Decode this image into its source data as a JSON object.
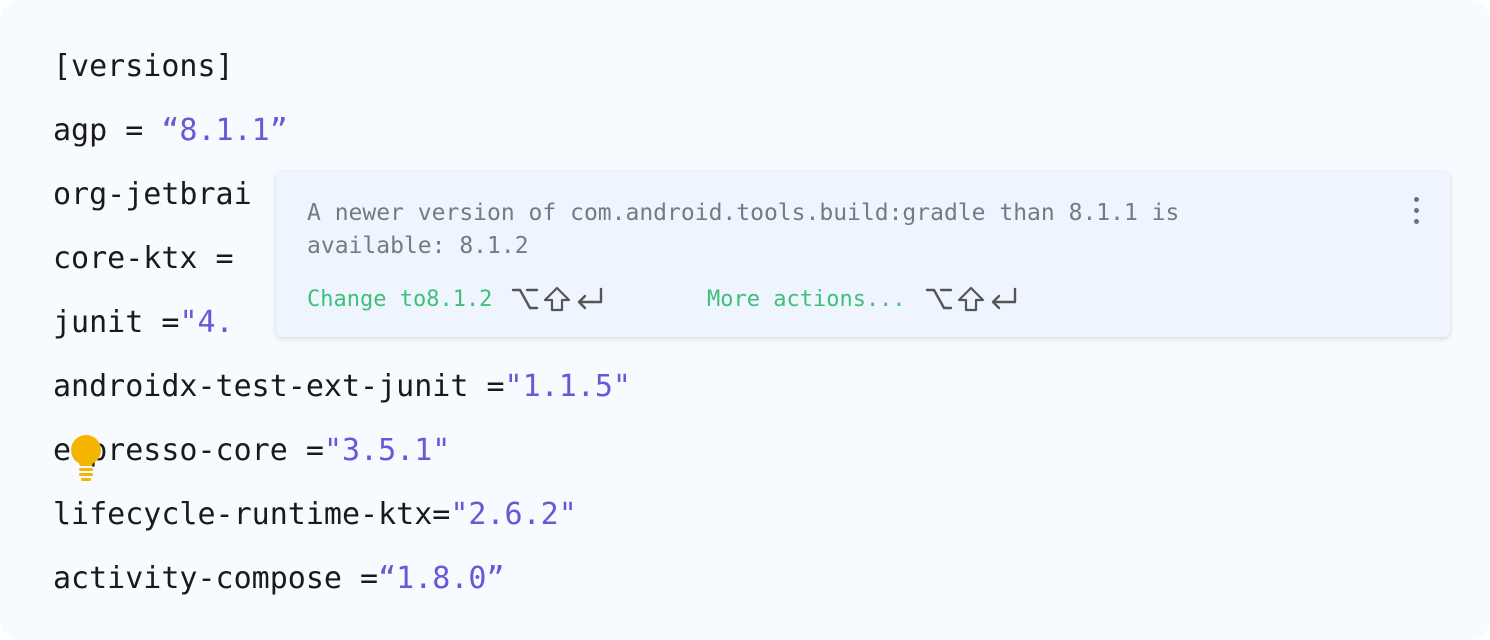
{
  "editor": {
    "lines": [
      {
        "key": "[versions]",
        "value": ""
      },
      {
        "key": "agp = ",
        "value": "“8.1.1”"
      },
      {
        "key": "org-jetbrai",
        "value": ""
      },
      {
        "key": "core-ktx = ",
        "value": ""
      },
      {
        "key": "junit =",
        "value": "\"4."
      },
      {
        "key": "androidx-test-ext-junit =",
        "value": "\"1.1.5\""
      },
      {
        "key": "espresso-core =",
        "value": "\"3.5.1\""
      },
      {
        "key": "lifecycle-runtime-ktx=",
        "value": "\"2.6.2\""
      },
      {
        "key": "activity-compose =",
        "value": "“1.8.0”"
      }
    ]
  },
  "popup": {
    "message_line1": "A newer version of com.android.tools.build:gradle than 8.1.1 is",
    "message_line2": "available: 8.1.2",
    "fix_label": "Change to8.1.2",
    "more_label": "More actions...",
    "shortcut_icons": [
      "option-key-icon",
      "shift-key-icon",
      "return-key-icon"
    ]
  },
  "colors": {
    "background": "#f7faff",
    "string": "#6b56d6",
    "action": "#3fbf7a",
    "bulb": "#f5b400",
    "popup_bg": "#eef5ff"
  }
}
